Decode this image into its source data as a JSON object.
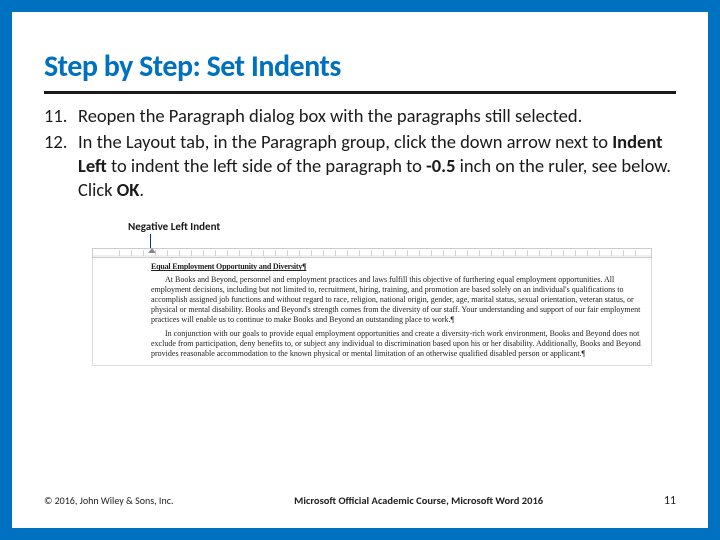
{
  "title": "Step by Step: Set Indents",
  "steps": [
    {
      "num": "11.",
      "text": "Reopen the Paragraph dialog box with the paragraphs still selected."
    },
    {
      "num": "12.",
      "pre": "In the Layout tab, in the Paragraph group, click the down arrow next to ",
      "bold1": "Indent Left",
      "mid": " to indent the left side of the paragraph to ",
      "bold2": "-0.5",
      "post": " inch on the ruler, see below. Click ",
      "bold3": "OK",
      "tail": "."
    }
  ],
  "figure": {
    "callout": "Negative Left Indent",
    "heading": "Equal Employment Opportunity and Diversity¶",
    "para1": "At Books and Beyond, personnel and employment practices and laws fulfill this objective of furthering equal employment opportunities. All employment decisions, including but not limited to, recruitment, hiring, training, and promotion are based solely on an individual's qualifications to accomplish assigned job functions and without regard to race, religion, national origin, gender, age, marital status, sexual orientation, veteran status, or physical or mental disability. Books and Beyond's strength comes from the diversity of our staff. Your understanding and support of our fair employment practices will enable us to continue to make Books and Beyond an outstanding place to work.¶",
    "para2": "In conjunction with our goals to provide equal employment opportunities and create a diversity-rich work environment, Books and Beyond does not exclude from participation, deny benefits to, or subject any individual to discrimination based upon his or her disability. Additionally, Books and Beyond provides reasonable accommodation to the known physical or mental limitation of an otherwise qualified disabled person or applicant.¶"
  },
  "footer": {
    "left": "© 2016, John Wiley & Sons, Inc.",
    "center": "Microsoft Official Academic Course, Microsoft Word 2016",
    "right": "11"
  }
}
